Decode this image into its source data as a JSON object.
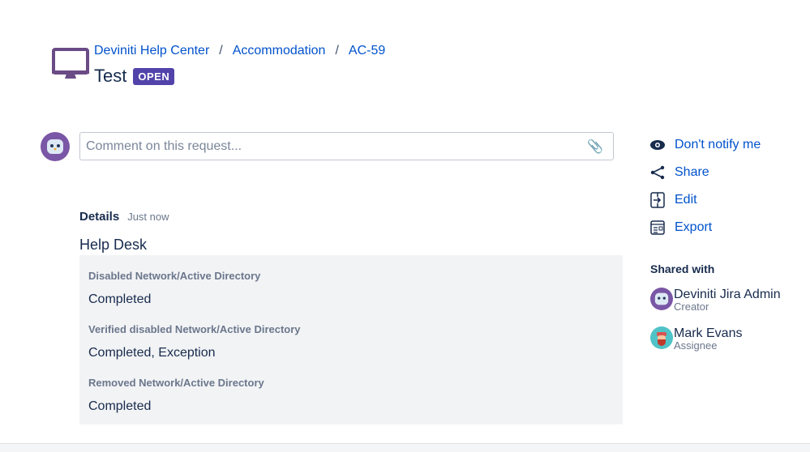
{
  "breadcrumb": [
    "Deviniti Help Center",
    "Accommodation",
    "AC-59"
  ],
  "request": {
    "title": "Test",
    "status": "OPEN"
  },
  "comment": {
    "placeholder": "Comment on this request..."
  },
  "details": {
    "label": "Details",
    "time": "Just now",
    "form_title": "Help Desk",
    "fields": [
      {
        "label": "Disabled Network/Active Directory",
        "value": "Completed"
      },
      {
        "label": "Verified disabled Network/Active Directory",
        "value": "Completed, Exception"
      },
      {
        "label": "Removed Network/Active Directory",
        "value": "Completed"
      }
    ]
  },
  "actions": [
    {
      "label": "Don't notify me",
      "icon": "eye-icon"
    },
    {
      "label": "Share",
      "icon": "share-icon"
    },
    {
      "label": "Edit",
      "icon": "edit-icon"
    },
    {
      "label": "Export",
      "icon": "export-icon"
    }
  ],
  "shared_with": {
    "title": "Shared with",
    "people": [
      {
        "name": "Deviniti Jira Admin",
        "role": "Creator"
      },
      {
        "name": "Mark Evans",
        "role": "Assignee"
      }
    ]
  },
  "colors": {
    "link": "#0052cc",
    "badge": "#5243aa",
    "icon": "#6a3f8b"
  }
}
